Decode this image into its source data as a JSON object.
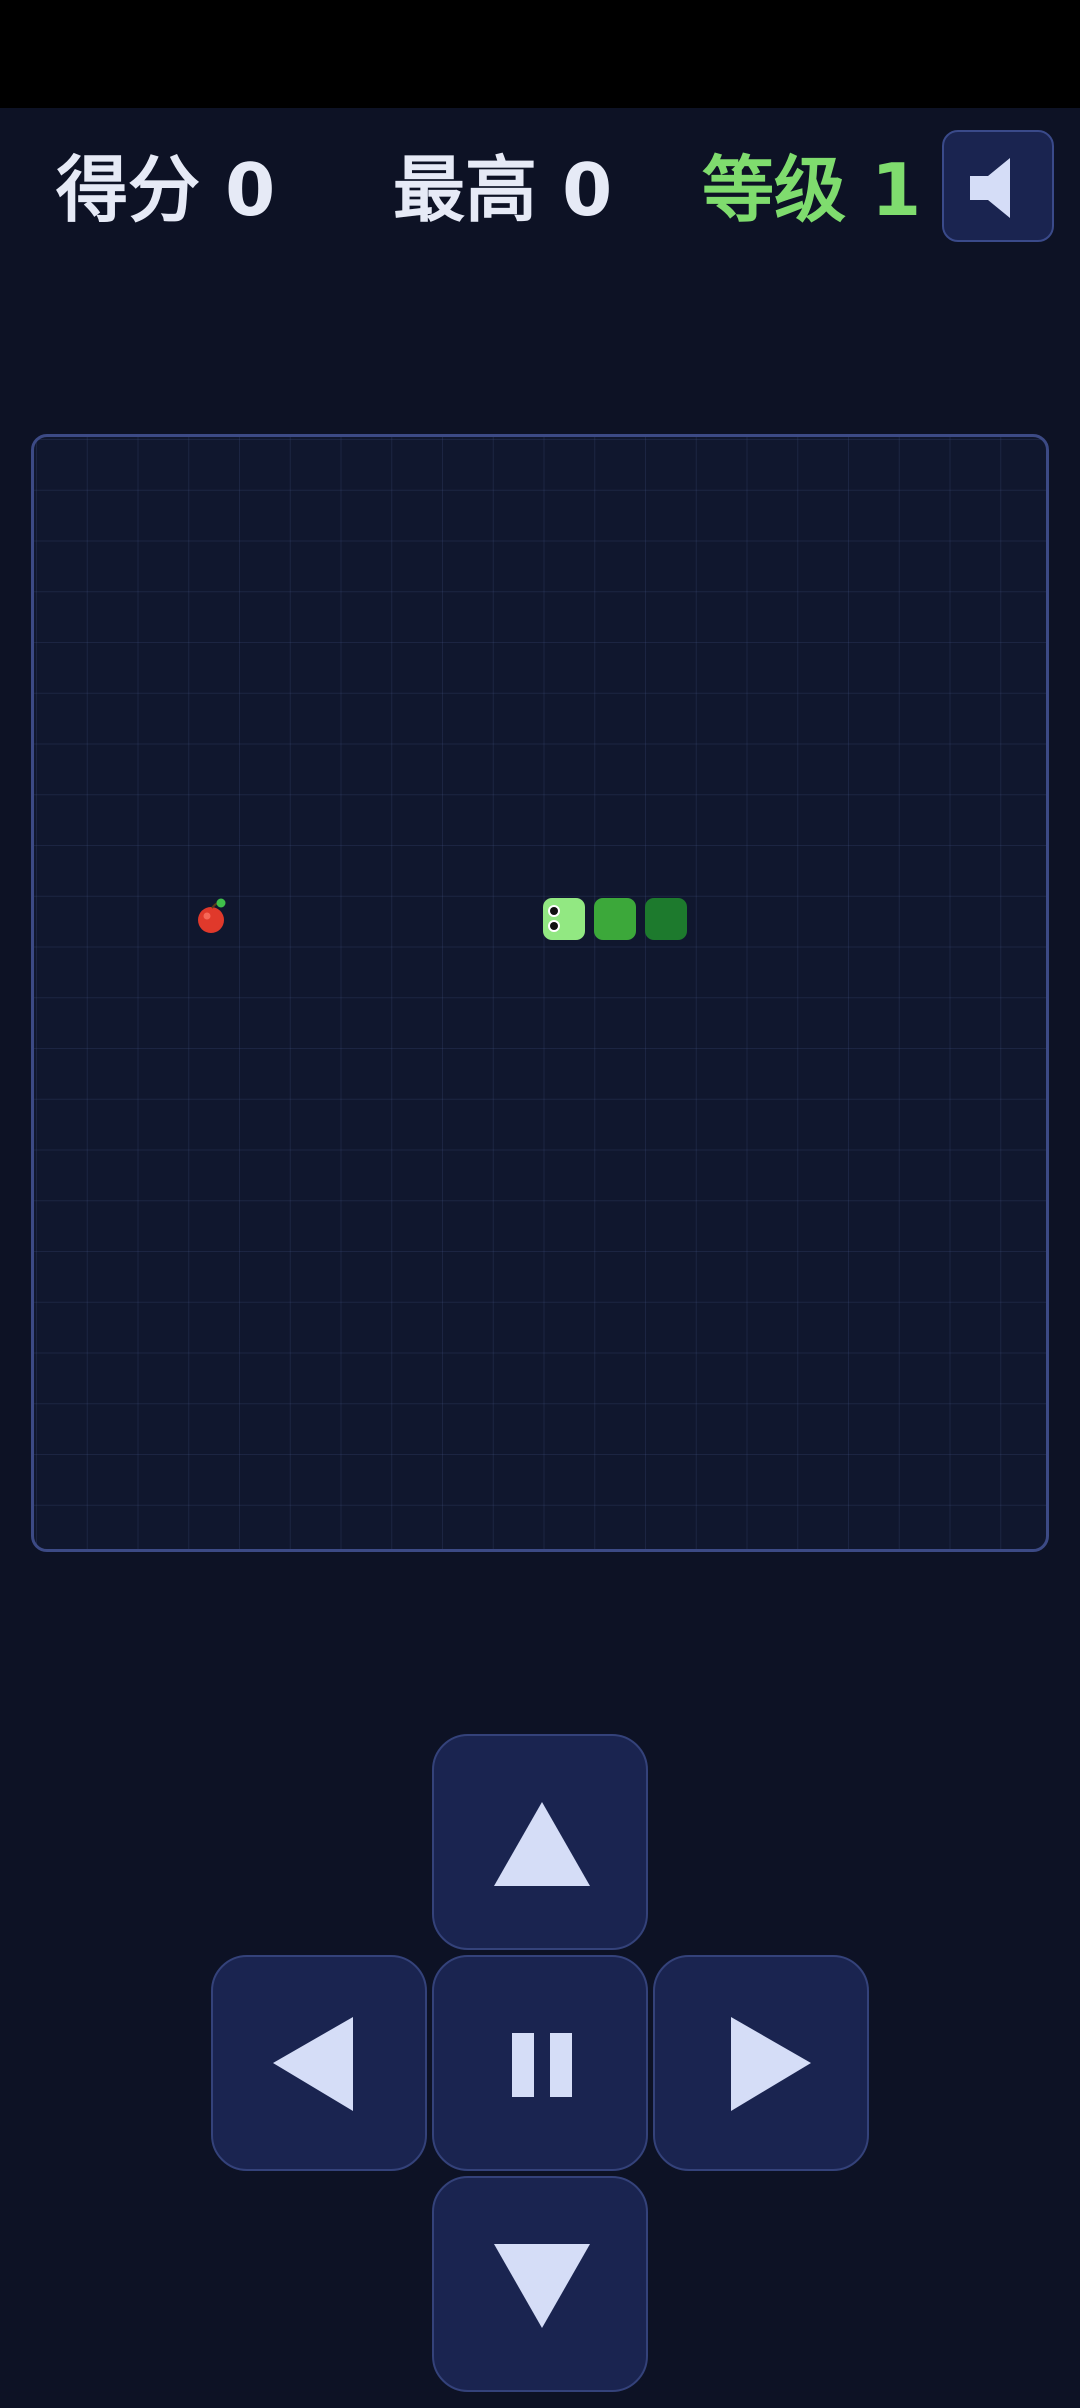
{
  "hud": {
    "score": "得分 0",
    "best": "最高 0",
    "level": "等级 1"
  },
  "icons": {
    "sound": "speaker-icon",
    "up": "arrow-up-icon",
    "left": "arrow-left-icon",
    "pause": "pause-icon",
    "right": "arrow-right-icon",
    "down": "arrow-down-icon"
  },
  "game": {
    "grid": {
      "cols": 20,
      "rows": 22
    },
    "snake": [
      {
        "col": 10,
        "row": 9,
        "part": "head"
      },
      {
        "col": 11,
        "row": 9,
        "part": "body"
      },
      {
        "col": 12,
        "row": 9,
        "part": "tail"
      }
    ],
    "food": {
      "col": 3,
      "row": 9,
      "type": "apple"
    }
  },
  "colors": {
    "background": "#0d1225",
    "level_text": "#7fdc6e",
    "snake_head": "#92e882",
    "snake_body": "#3ca83a",
    "snake_tail": "#1d7a2d",
    "apple": "#e0392b",
    "button_fill": "#1a2450",
    "icon_fill": "#d5ddf7"
  }
}
